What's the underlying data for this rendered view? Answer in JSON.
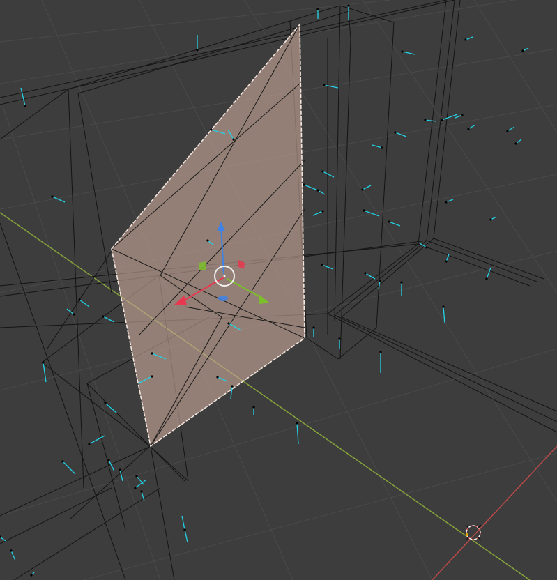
{
  "viewport": {
    "mode": "edit-mode-wireframe",
    "view": "perspective",
    "background_color": "#3d3d3d",
    "grid_color": "#4a4a4a",
    "grid_minor_color": "#454545",
    "wire_color": "#111111",
    "x_axis_color": "#b84a4a",
    "y_axis_color": "#86a23a",
    "normal_color": "#22d3e6",
    "selected_face_color": "#c8a89a",
    "selected_edge_color": "#f2e6df",
    "gizmo": {
      "x_axis_color": "#e8384f",
      "y_axis_color": "#7cbf2a",
      "z_axis_color": "#3c82e8",
      "center_color": "#f0f0f0"
    },
    "cursor_3d_color": "#e05050",
    "selection": {
      "element": "face",
      "count": 1
    }
  }
}
